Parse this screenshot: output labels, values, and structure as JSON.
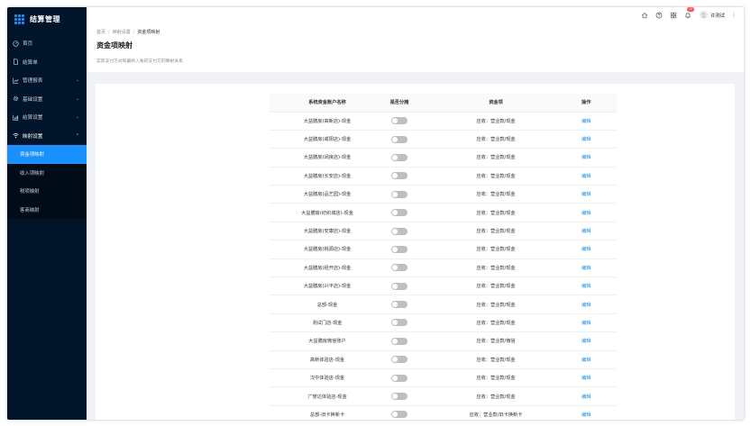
{
  "app": {
    "title": "结算管理"
  },
  "sidebar": {
    "items": [
      {
        "label": "首页",
        "icon": "dashboard-icon",
        "chevron": ""
      },
      {
        "label": "结算单",
        "icon": "file-icon",
        "chevron": ""
      },
      {
        "label": "管理报表",
        "icon": "chart-icon",
        "chevron": "⌄"
      },
      {
        "label": "基础设置",
        "icon": "gear-icon",
        "chevron": "⌄"
      },
      {
        "label": "结算设置",
        "icon": "bar-chart-icon",
        "chevron": "⌄"
      },
      {
        "label": "映射设置",
        "icon": "wifi-icon",
        "chevron": "⌃"
      }
    ],
    "sub_items": [
      {
        "label": "资金项映射",
        "active": true
      },
      {
        "label": "收入项映射",
        "active": false
      },
      {
        "label": "税项映射",
        "active": false
      },
      {
        "label": "客商映射",
        "active": false
      }
    ]
  },
  "header": {
    "badge": "10",
    "user_name": "许测试",
    "more": "⋮"
  },
  "page": {
    "breadcrumb": [
      "首页",
      "映射设置",
      "资金项映射"
    ],
    "title": "资金项映射",
    "description": "实际支付方式和最终入账的支付方的映射关系"
  },
  "table": {
    "headers": [
      "系统资金账户名称",
      "是否分摊",
      "资金项",
      "操作"
    ],
    "rows": [
      {
        "name": "大益膳房(高新店)-现金",
        "split": false,
        "item": "应收：营业款/现金",
        "action": "编辑"
      },
      {
        "name": "大益膳房(咸阳店)-现金",
        "split": false,
        "item": "应收：营业款/现金",
        "action": "编辑"
      },
      {
        "name": "大益膳房(阔良店)-现金",
        "split": false,
        "item": "应收：营业款/现金",
        "action": "编辑"
      },
      {
        "name": "大益膳房(长安店)-现金",
        "split": false,
        "item": "应收：营业款/现金",
        "action": "编辑"
      },
      {
        "name": "大益膳房(品艺园)-现金",
        "split": false,
        "item": "应收：营业款/现金",
        "action": "编辑"
      },
      {
        "name": "大益膳房(纺织城店)-现金",
        "split": false,
        "item": "应收：营业款/现金",
        "action": "编辑"
      },
      {
        "name": "大益膳房(安康店)-现金",
        "split": false,
        "item": "应收：营业款/现金",
        "action": "编辑"
      },
      {
        "name": "大益膳房(桃源店)-现金",
        "split": false,
        "item": "应收：营业款/现金",
        "action": "编辑"
      },
      {
        "name": "大益膳房(经开店)-现金",
        "split": false,
        "item": "应收：营业款/现金",
        "action": "编辑"
      },
      {
        "name": "大益膳房(兴平店)-现金",
        "split": false,
        "item": "应收：营业款/现金",
        "action": "编辑"
      },
      {
        "name": "总部-现金",
        "split": false,
        "item": "应收：营业款/现金",
        "action": "编辑"
      },
      {
        "name": "测试门店-现金",
        "split": false,
        "item": "应收：营业款/现金",
        "action": "编辑"
      },
      {
        "name": "大益膳房微信账户",
        "split": false,
        "item": "应收：营业款/微信",
        "action": "编辑"
      },
      {
        "name": "高新体验店-现金",
        "split": false,
        "item": "应收：营业款/现金",
        "action": "编辑"
      },
      {
        "name": "汉中体验店-现金",
        "split": false,
        "item": "应收：营业款/现金",
        "action": "编辑"
      },
      {
        "name": "广誉达体验店-现金",
        "split": false,
        "item": "应收：营业款/现金",
        "action": "编辑"
      },
      {
        "name": "总部-旧卡换新卡",
        "split": false,
        "item": "应收：营业款/旧卡换新卡",
        "action": "编辑"
      }
    ]
  },
  "colors": {
    "sidebar_bg": "#001529",
    "accent": "#1890ff",
    "badge": "#ff4d4f"
  }
}
